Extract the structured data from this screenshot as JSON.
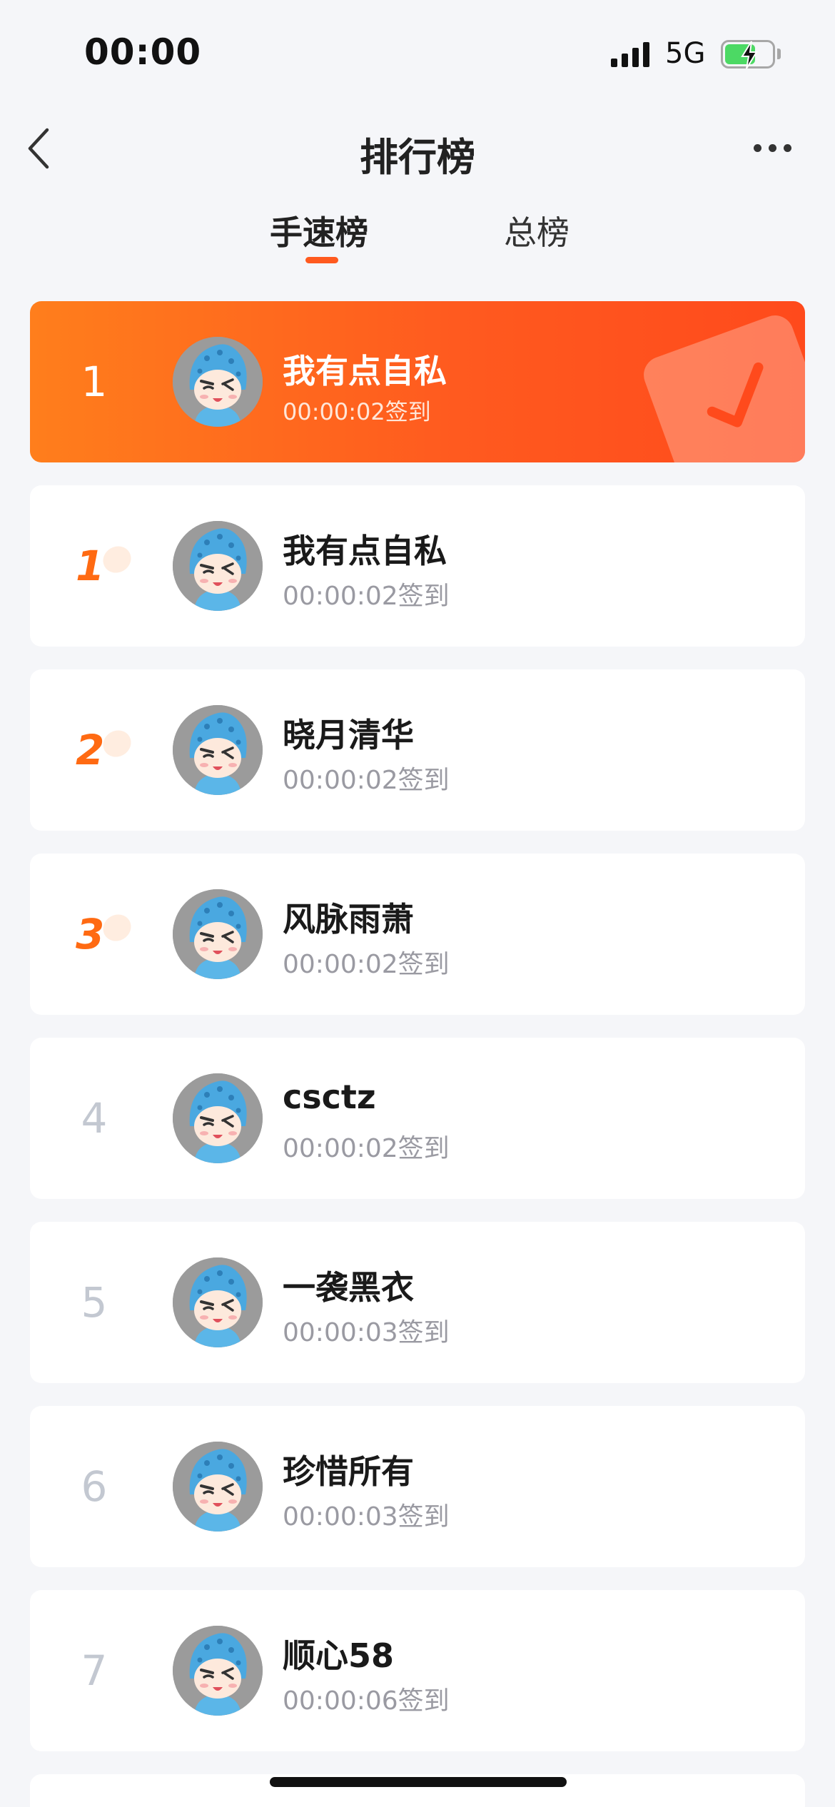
{
  "status_bar": {
    "time": "00:00",
    "network": "5G"
  },
  "header": {
    "title": "排行榜"
  },
  "tabs": [
    {
      "label": "手速榜",
      "active": true
    },
    {
      "label": "总榜",
      "active": false
    }
  ],
  "my_entry": {
    "rank": "1",
    "name": "我有点自私",
    "time": "00:00:02签到"
  },
  "ranking": [
    {
      "rank": "1",
      "name": "我有点自私",
      "time": "00:00:02签到"
    },
    {
      "rank": "2",
      "name": "晓月清华",
      "time": "00:00:02签到"
    },
    {
      "rank": "3",
      "name": "风脉雨萧",
      "time": "00:00:02签到"
    },
    {
      "rank": "4",
      "name": "csctz",
      "time": "00:00:02签到"
    },
    {
      "rank": "5",
      "name": "一袭黑衣",
      "time": "00:00:03签到"
    },
    {
      "rank": "6",
      "name": "珍惜所有",
      "time": "00:00:03签到"
    },
    {
      "rank": "7",
      "name": "顺心58",
      "time": "00:00:06签到"
    }
  ],
  "colors": {
    "accent": "#ff5a1f",
    "background": "#f5f6f9",
    "rank_gray": "#c3c8d1"
  }
}
